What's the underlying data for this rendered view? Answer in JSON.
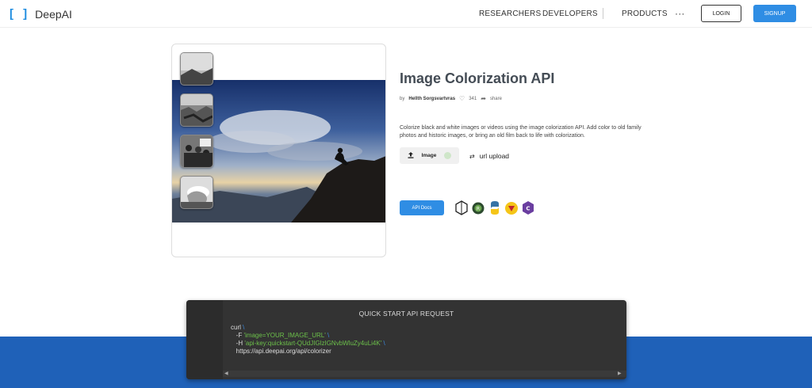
{
  "header": {
    "logo_bracket": "[ ]",
    "logo_name": "DeepAI",
    "nav": [
      "RESEARCHERS",
      "DEVELOPERS",
      "PRODUCTS"
    ],
    "more": "···",
    "login": "LOGIN",
    "signup": "SIGNUP"
  },
  "api": {
    "title": "Image Colorization API",
    "byline_prefix": "by",
    "author": "Hellth Sorgsvartvras",
    "likes": "341",
    "share": "share",
    "description": "Colorize black and white images or videos using the image colorization API. Add color to old family photos and historic images, or bring an old film back to life with colorization.",
    "image_tab": "Image",
    "url_tab": "url upload",
    "docs_button": "API Docs",
    "lang_icons": [
      "nodejs-icon",
      "r-icon",
      "python-icon",
      "ruby-icon",
      "csharp-icon"
    ]
  },
  "code": {
    "title": "QUICK START API REQUEST",
    "line1": "curl",
    "line2_flag": "-F",
    "line2_val": "'image=YOUR_IMAGE_URL'",
    "line3_flag": "-H",
    "line3_val": "'api-key:quickstart-QUdJIGlzIGNvbWluZy4uLi4K'",
    "line4": "https://api.deepai.org/api/colorizer",
    "continuation": "\\"
  },
  "colors": {
    "accent": "#2f8de4",
    "band": "#1f61b8",
    "code_bg": "#333333"
  }
}
